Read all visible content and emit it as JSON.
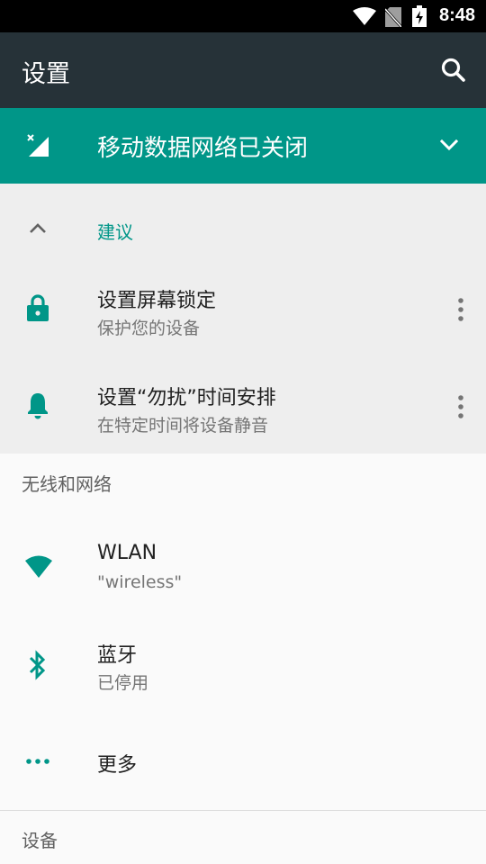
{
  "status_bar": {
    "time": "8:48"
  },
  "app_bar": {
    "title": "设置"
  },
  "banner": {
    "label": "移动数据网络已关闭"
  },
  "suggestions": {
    "header": "建议",
    "items": [
      {
        "title": "设置屏幕锁定",
        "subtitle": "保护您的设备",
        "icon": "lock-icon"
      },
      {
        "title": "设置“勿扰”时间安排",
        "subtitle": "在特定时间将设备静音",
        "icon": "bell-icon"
      }
    ]
  },
  "wireless_section": {
    "header": "无线和网络",
    "items": [
      {
        "title": "WLAN",
        "subtitle": "\"wireless\"",
        "icon": "wifi-icon"
      },
      {
        "title": "蓝牙",
        "subtitle": "已停用",
        "icon": "bluetooth-icon"
      },
      {
        "title": "更多",
        "icon": "more-horiz-icon"
      }
    ]
  },
  "device_section": {
    "header": "设备"
  },
  "colors": {
    "accent": "#009688",
    "app_bar": "#263238",
    "status_bar": "#000000"
  }
}
